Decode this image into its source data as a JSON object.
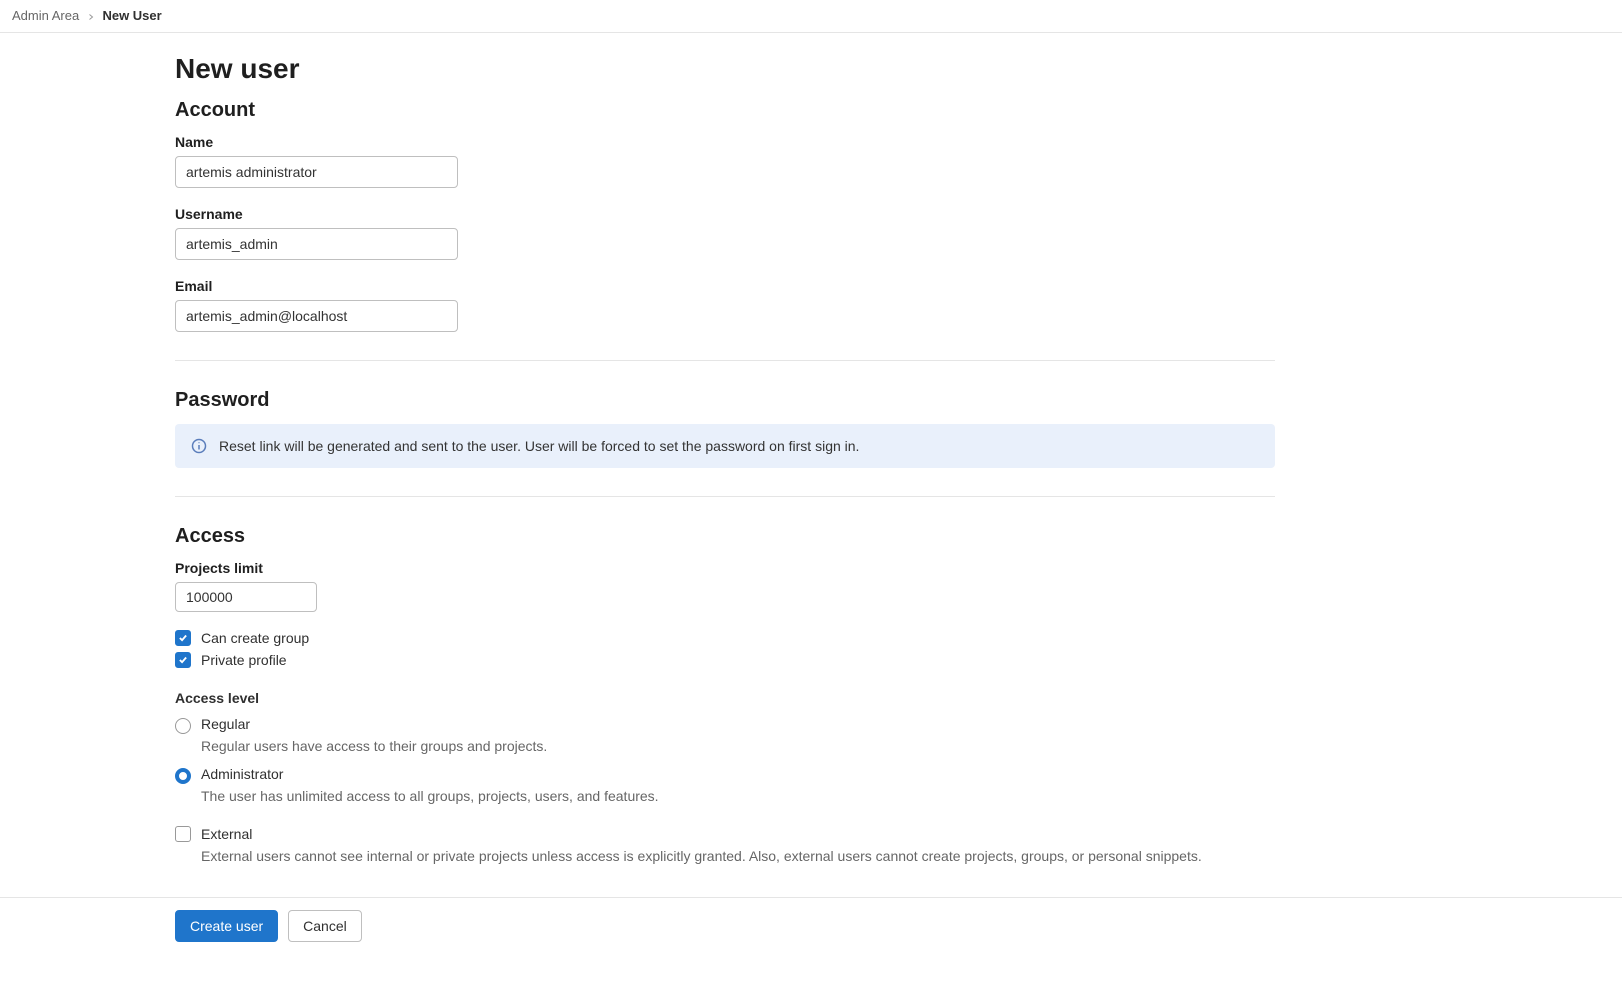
{
  "breadcrumb": {
    "root": "Admin Area",
    "current": "New User"
  },
  "page": {
    "title": "New user"
  },
  "account": {
    "heading": "Account",
    "name_label": "Name",
    "name_value": "artemis administrator",
    "username_label": "Username",
    "username_value": "artemis_admin",
    "email_label": "Email",
    "email_value": "artemis_admin@localhost"
  },
  "password": {
    "heading": "Password",
    "info_text": "Reset link will be generated and sent to the user. User will be forced to set the password on first sign in."
  },
  "access": {
    "heading": "Access",
    "projects_limit_label": "Projects limit",
    "projects_limit_value": "100000",
    "can_create_group_label": "Can create group",
    "can_create_group_checked": true,
    "private_profile_label": "Private profile",
    "private_profile_checked": true,
    "access_level_label": "Access level",
    "regular": {
      "label": "Regular",
      "desc": "Regular users have access to their groups and projects.",
      "selected": false
    },
    "administrator": {
      "label": "Administrator",
      "desc": "The user has unlimited access to all groups, projects, users, and features.",
      "selected": true
    },
    "external": {
      "label": "External",
      "desc": "External users cannot see internal or private projects unless access is explicitly granted. Also, external users cannot create projects, groups, or personal snippets.",
      "checked": false
    }
  },
  "footer": {
    "create_label": "Create user",
    "cancel_label": "Cancel"
  }
}
